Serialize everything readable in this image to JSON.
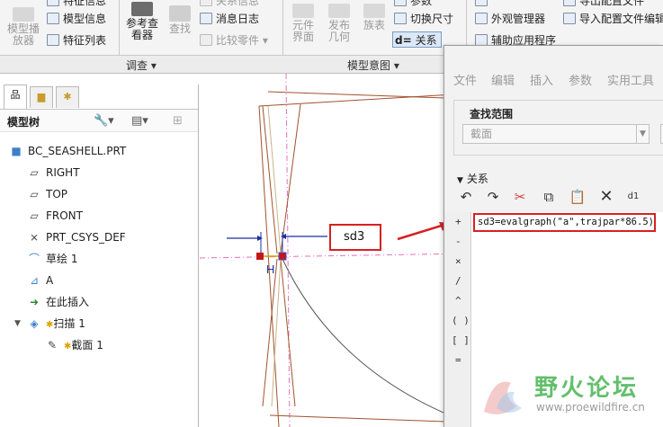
{
  "ribbon": {
    "groups": {
      "investigate": "调查 ▾",
      "model_intent": "模型意图 ▾"
    },
    "buttons": {
      "model_player": "模型播\n放器",
      "feature_info": "特征信息",
      "model_info": "模型信息",
      "feature_list": "特征列表",
      "reference_viewer": "参考查\n看器",
      "find": "查找",
      "relations_top": "关系信息",
      "message_log": "消息日志",
      "compare_parts": "比较零件 ▾",
      "component_interface": "元件\n界面",
      "publish_geometry": "发布\n几何",
      "family_table": "族表",
      "switch_dimensions": "切换尺寸",
      "relations": "关系",
      "parameters": "参数",
      "appearance_manager": "外观管理器",
      "auxiliary_apps": "辅助应用程序",
      "import_config": "导入配置文件编辑",
      "export_config": "导出配置文件"
    }
  },
  "model_tree": {
    "title": "模型树",
    "items": [
      {
        "label": "BC_SEASHELL.PRT",
        "icon": "part-icon"
      },
      {
        "label": "RIGHT",
        "icon": "datum-plane-icon"
      },
      {
        "label": "TOP",
        "icon": "datum-plane-icon"
      },
      {
        "label": "FRONT",
        "icon": "datum-plane-icon"
      },
      {
        "label": "PRT_CSYS_DEF",
        "icon": "csys-icon"
      },
      {
        "label": "草绘 1",
        "icon": "sketch-icon"
      },
      {
        "label": "A",
        "icon": "graph-icon"
      },
      {
        "label": "在此插入",
        "icon": "insert-arrow-icon"
      },
      {
        "label": "扫描 1",
        "icon": "sweep-icon"
      },
      {
        "label": "截面 1",
        "icon": "section-icon"
      }
    ]
  },
  "canvas": {
    "dimension_label": "sd3",
    "sketch_marker": "H"
  },
  "relations_dialog": {
    "menu": [
      "文件",
      "编辑",
      "插入",
      "参数",
      "实用工具"
    ],
    "scope_title": "查找范围",
    "scope_value": "截面",
    "relations_title": "关系",
    "operators": [
      "+",
      "-",
      "×",
      "/",
      "^",
      "( )",
      "[ ]",
      "="
    ],
    "relation_text": "sd3=evalgraph(\"a\",trajpar*86.5)"
  },
  "watermark": {
    "title": "野火论坛",
    "url": "www.proewildfire.cn"
  },
  "colors": {
    "highlight": "#d62020",
    "sketch": "#a0522d",
    "datum": "#e36fc0",
    "dimension": "#1a2fa0",
    "watermark": "#3caf46"
  }
}
